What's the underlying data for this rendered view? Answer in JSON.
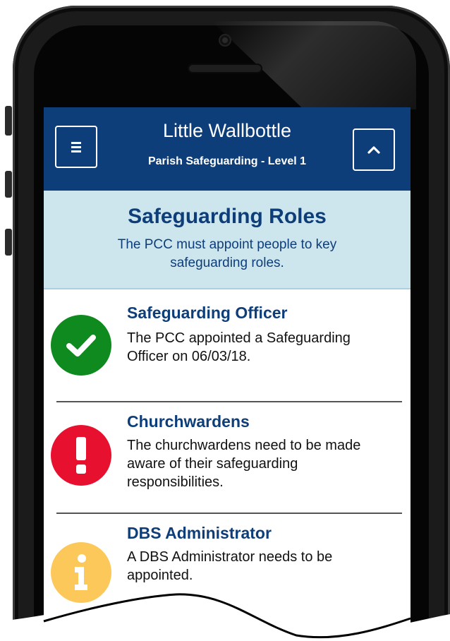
{
  "header": {
    "title": "Little Wallbottle",
    "subtitle": "Parish Safeguarding - Level 1",
    "menu_icon": "hamburger-menu-icon",
    "up_icon": "chevron-up-icon"
  },
  "banner": {
    "title": "Safeguarding Roles",
    "description": "The PCC must appoint people to key safeguarding roles."
  },
  "roles": [
    {
      "title": "Safeguarding Officer",
      "description": "The PCC appointed a Safeguarding Officer on 06/03/18.",
      "status": "complete",
      "icon": "checkmark-icon",
      "color": "#0f8a1f"
    },
    {
      "title": "Churchwardens",
      "description": "The churchwardens need to be made aware of their safeguarding responsibilities.",
      "status": "alert",
      "icon": "exclamation-icon",
      "color": "#e8102f"
    },
    {
      "title": "DBS Administrator",
      "description": "A DBS Administrator needs to be appointed.",
      "status": "info",
      "icon": "info-icon",
      "color": "#fcc85a"
    }
  ],
  "colors": {
    "header_bg": "#0e3e79",
    "banner_bg": "#cde6ee",
    "heading_text": "#0e3e79"
  }
}
